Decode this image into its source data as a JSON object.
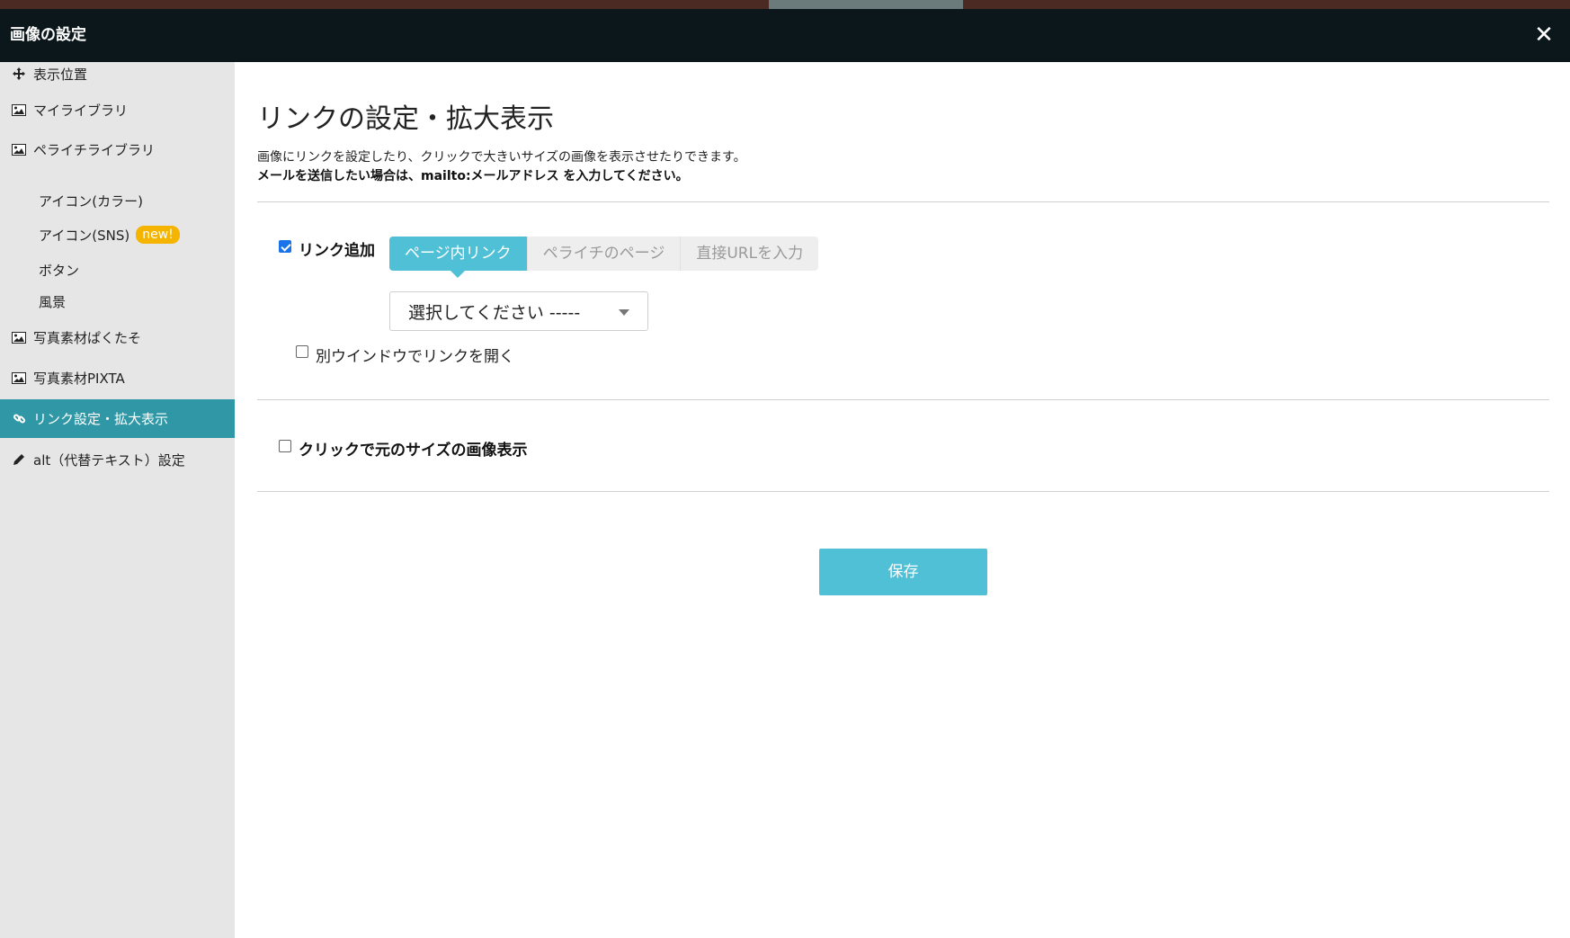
{
  "dialog": {
    "title": "画像の設定",
    "close_icon": "close-icon"
  },
  "sidebar": {
    "items": [
      {
        "label": "表示位置",
        "icon": "move-icon"
      },
      {
        "label": "マイライブラリ",
        "icon": "image-icon"
      },
      {
        "label": "ペライチライブラリ",
        "icon": "image-icon"
      },
      {
        "label": "写真素材ぱくたそ",
        "icon": "image-icon"
      },
      {
        "label": "写真素材PIXTA",
        "icon": "image-icon"
      },
      {
        "label": "リンク設定・拡大表示",
        "icon": "link-icon",
        "active": true
      },
      {
        "label": "alt（代替テキスト）設定",
        "icon": "pencil-icon"
      }
    ],
    "subitems": [
      {
        "label": "アイコン(カラー)"
      },
      {
        "label": "アイコン(SNS)",
        "badge": "new!"
      },
      {
        "label": "ボタン"
      },
      {
        "label": "風景"
      }
    ],
    "active_color": "#2f97a5",
    "badge_color": "#f5b400"
  },
  "main": {
    "heading": "リンクの設定・拡大表示",
    "desc1": "画像にリンクを設定したり、クリックで大きいサイズの画像を表示させたりできます。",
    "desc2": "メールを送信したい場合は、mailto:メールアドレス を入力してください。",
    "link_add": {
      "label": "リンク追加",
      "checked": true,
      "tabs": [
        {
          "label": "ページ内リンク",
          "selected": true
        },
        {
          "label": "ペライチのページ",
          "selected": false
        },
        {
          "label": "直接URLを入力",
          "selected": false
        }
      ],
      "select_value": "選択してください -----",
      "new_window_label": "別ウインドウでリンクを開く",
      "new_window_checked": false
    },
    "original_size": {
      "label": "クリックで元のサイズの画像表示",
      "checked": false
    },
    "save_label": "保存",
    "accent_color": "#4fc0d6"
  }
}
